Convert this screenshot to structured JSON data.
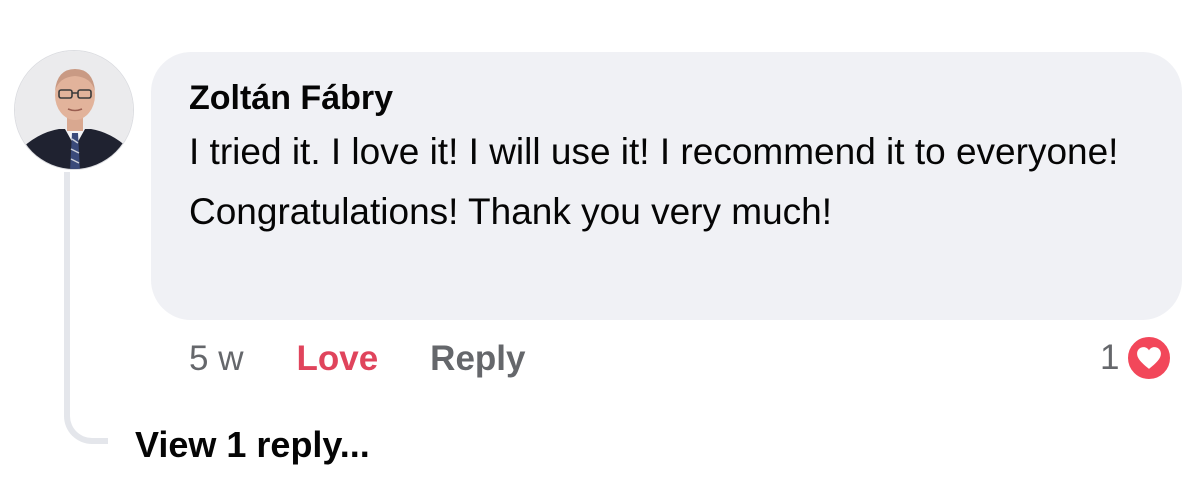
{
  "comment": {
    "author": "Zoltán Fábry",
    "text": "I tried it.  I love it!  I will use it!  I recommend it to everyone!  Congratulations!  Thank you very much!",
    "timestamp": "5 w",
    "love_label": "Love",
    "reply_label": "Reply",
    "reaction_count": "1",
    "reaction_icon": "heart-icon",
    "love_color": "#e0445c",
    "bubble_color": "#f0f1f5",
    "secondary_text_color": "#65676b"
  },
  "replies": {
    "view_label": "View 1 reply..."
  }
}
